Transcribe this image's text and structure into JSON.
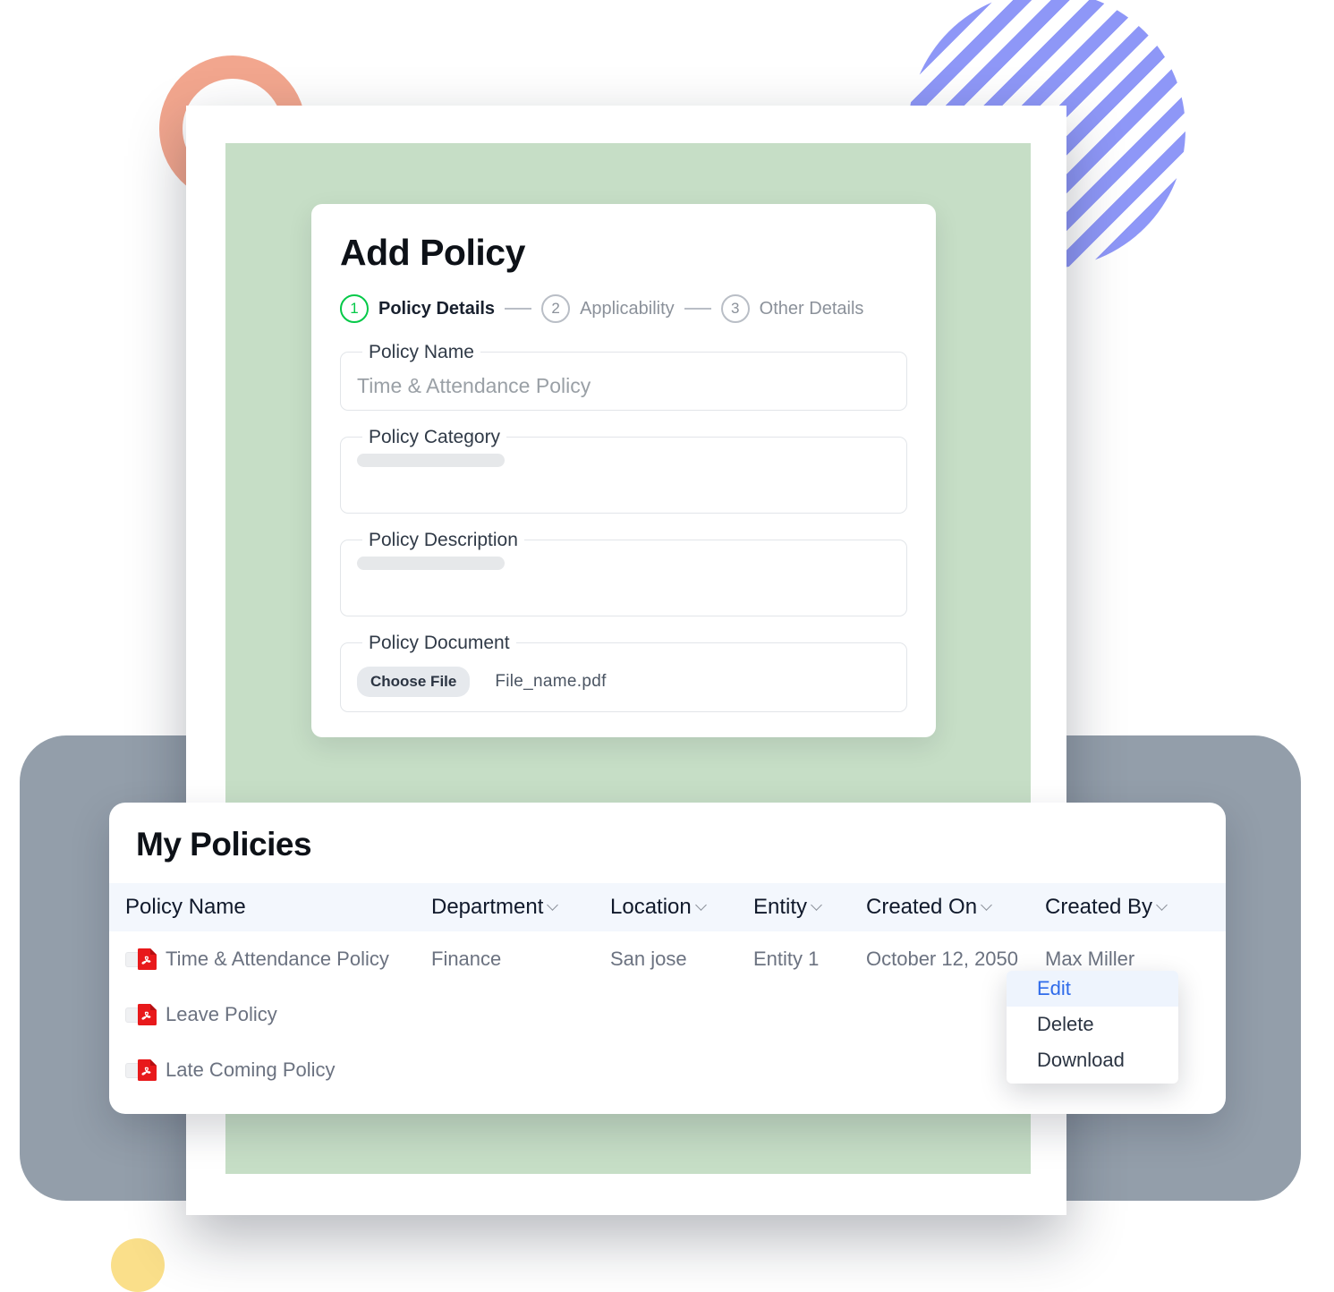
{
  "add_policy": {
    "title": "Add Policy",
    "steps": [
      {
        "number": "1",
        "label": "Policy Details",
        "state": "active"
      },
      {
        "number": "2",
        "label": "Applicability",
        "state": "inactive"
      },
      {
        "number": "3",
        "label": "Other Details",
        "state": "inactive"
      }
    ],
    "fields": {
      "policy_name": {
        "label": "Policy Name",
        "placeholder": "Time & Attendance Policy",
        "value": ""
      },
      "policy_category": {
        "label": "Policy Category",
        "value": ""
      },
      "policy_description": {
        "label": "Policy Description",
        "value": ""
      },
      "policy_document": {
        "label": "Policy Document",
        "button": "Choose File",
        "file": "File_name.pdf"
      }
    }
  },
  "my_policies": {
    "title": "My Policies",
    "columns": [
      {
        "label": "Policy Name",
        "sortable": false
      },
      {
        "label": "Department",
        "sortable": true
      },
      {
        "label": "Location",
        "sortable": true
      },
      {
        "label": "Entity",
        "sortable": true
      },
      {
        "label": "Created On",
        "sortable": true
      },
      {
        "label": "Created By",
        "sortable": true
      }
    ],
    "rows": [
      {
        "name": "Time & Attendance Policy",
        "department": "Finance",
        "location": "San jose",
        "entity": "Entity 1",
        "created_on": "October 12, 2050",
        "created_by": "Max Miller",
        "redacted": false
      },
      {
        "name": "Leave Policy",
        "department": "",
        "location": "",
        "entity": "",
        "created_on": "",
        "created_by": "",
        "redacted": true
      },
      {
        "name": "Late Coming Policy",
        "department": "",
        "location": "",
        "entity": "",
        "created_on": "",
        "created_by": "",
        "redacted": true
      }
    ],
    "row_menu": {
      "items": [
        {
          "label": "Edit",
          "highlighted": true
        },
        {
          "label": "Delete",
          "highlighted": false
        },
        {
          "label": "Download",
          "highlighted": false
        }
      ]
    }
  },
  "colors": {
    "step_active": "#05c948",
    "panel_green": "#c6dec6",
    "menu_link": "#2f6bea",
    "menu_highlight_bg": "#eef4fd",
    "pdf_red": "#e8191b",
    "deco_blue": "#8e97f7",
    "deco_coral": "#f2a68e",
    "deco_yellow": "#fadf8a",
    "table_header_bg": "#f3f7fd"
  }
}
